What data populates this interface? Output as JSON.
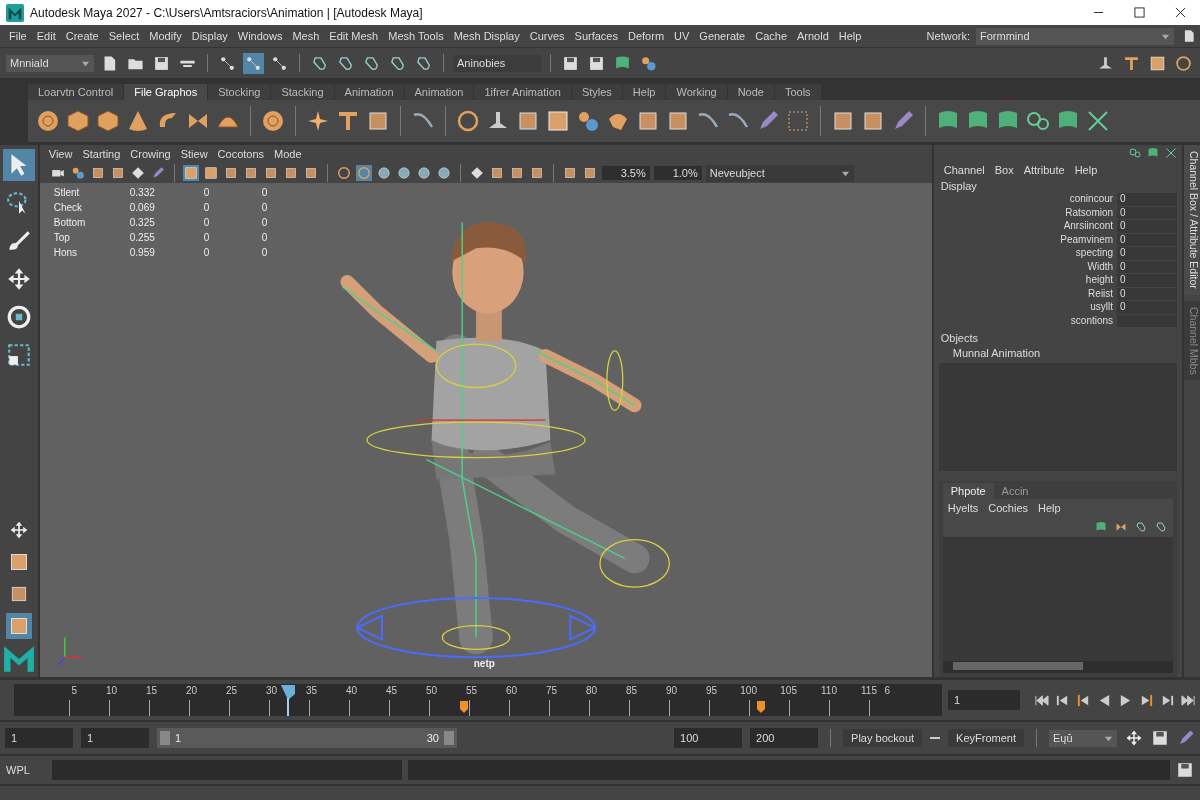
{
  "window": {
    "title": "Autodesk Maya 2027 - C:\\Users\\Amtsraciors\\Animation | [Autodesk Maya]"
  },
  "menu_bar": [
    "File",
    "Edit",
    "Create",
    "Select",
    "Modify",
    "Display",
    "Windows",
    "Mesh",
    "Edit Mesh",
    "Mesh Tools",
    "Mesh Display",
    "Curves",
    "Surfaces",
    "Deform",
    "UV",
    "Generate",
    "Cache",
    "Arnold",
    "Help"
  ],
  "network": {
    "label": "Network:",
    "value": "Formmind"
  },
  "status_line": {
    "mode": "Mnniald",
    "field": "Aninobies"
  },
  "shelf_tabs": [
    {
      "label": "Loarvtn Control",
      "selected": false
    },
    {
      "label": "File Graphos",
      "selected": true
    },
    {
      "label": "Stocking",
      "selected": false
    },
    {
      "label": "Stacking",
      "selected": false
    },
    {
      "label": "Animation",
      "selected": false
    },
    {
      "label": "Animation",
      "selected": false
    },
    {
      "label": "1ifrer Animation",
      "selected": false
    },
    {
      "label": "Styles",
      "selected": false
    },
    {
      "label": "Help",
      "selected": false
    },
    {
      "label": "Working",
      "selected": false
    },
    {
      "label": "Node",
      "selected": false
    },
    {
      "label": "Tools",
      "selected": false
    }
  ],
  "viewport": {
    "menu": [
      "View",
      "Starting",
      "Crowing",
      "Stiew",
      "Cocotons",
      "Mode"
    ],
    "field_1": "3.5%",
    "field_2": "1.0%",
    "camera": "Neveubject",
    "hud_rows": [
      {
        "name": "Stlent",
        "value": "0.332",
        "column_3": "0",
        "column_4": "0"
      },
      {
        "name": "Check",
        "value": "0.069",
        "column_3": "0",
        "column_4": "0"
      },
      {
        "name": "Bottom",
        "value": "0.325",
        "column_3": "0",
        "column_4": "0"
      },
      {
        "name": "Top",
        "value": "0.255",
        "column_3": "0",
        "column_4": "0"
      },
      {
        "name": "Hons",
        "value": "0.959",
        "column_3": "0",
        "column_4": "0"
      }
    ],
    "label": "netp"
  },
  "channel_box": {
    "menu": [
      "Channel",
      "Box",
      "Attribute",
      "Help"
    ],
    "section": "Display",
    "attributes": [
      {
        "name": "conincour",
        "value": "0"
      },
      {
        "name": "Ratsomion",
        "value": "0"
      },
      {
        "name": "Anrsiincont",
        "value": "0"
      },
      {
        "name": "Peamvinem",
        "value": "0"
      },
      {
        "name": "specting",
        "value": "0"
      },
      {
        "name": "Width",
        "value": "0"
      },
      {
        "name": "height",
        "value": "0"
      },
      {
        "name": "Reiist",
        "value": "0"
      },
      {
        "name": "usyllt",
        "value": "0"
      },
      {
        "name": "scontions"
      }
    ],
    "objects_header": "Objects",
    "object": "Munnal Animation"
  },
  "layer_editor": {
    "tabs": [
      {
        "label": "Phpote",
        "selected": true
      },
      {
        "label": "Accin",
        "selected": false
      }
    ],
    "menu": [
      "Hyelts",
      "Cochies",
      "Help"
    ]
  },
  "side_tabs": [
    {
      "label": "Channel Box / Attribute Editor",
      "selected": true
    },
    {
      "label": "Channel Mbbs",
      "selected": false
    }
  ],
  "timeline": {
    "ticks": [
      "5",
      "10",
      "15",
      "20",
      "25",
      "30",
      "35",
      "40",
      "45",
      "50",
      "55",
      "60",
      "75",
      "80",
      "85",
      "90",
      "95",
      "100",
      "105",
      "110",
      "115",
      "6"
    ],
    "playhead": {
      "level": 0.295
    },
    "keyframes": [
      {
        "level": 0.48
      },
      {
        "level": 0.8
      }
    ],
    "current_frame": "1"
  },
  "range": {
    "level": 1,
    "start": "1",
    "start_2": "1",
    "slider_start": "1",
    "slider_end": "30",
    "end": "100",
    "end_2": "200",
    "playback": "Play bockout",
    "key": "KeyFroment",
    "dropdown": "Eųū"
  },
  "command_line": {
    "label": "WPL"
  }
}
